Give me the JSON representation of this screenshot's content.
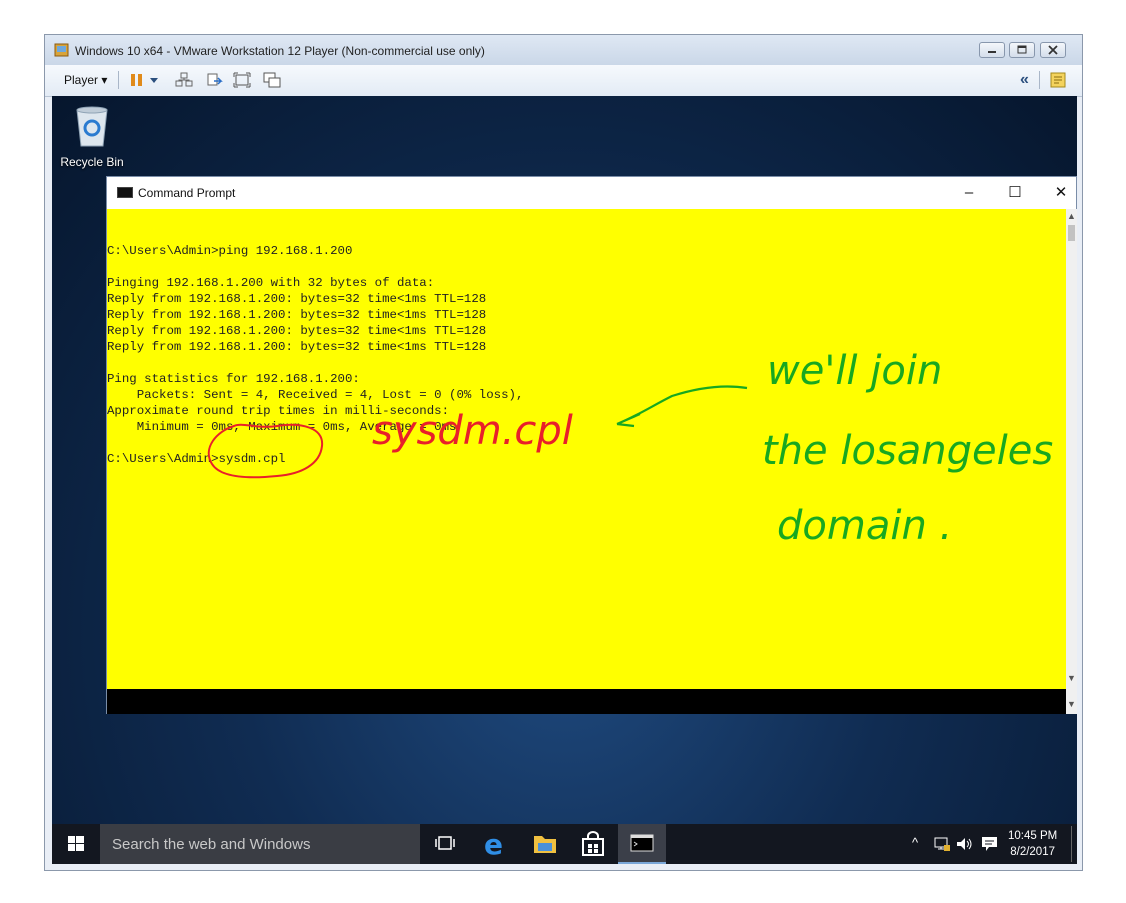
{
  "vmware": {
    "title": "Windows 10 x64 - VMware Workstation 12 Player (Non-commercial use only)",
    "player_menu": "Player ▾",
    "collapse_glyph": "«"
  },
  "desktop": {
    "recycle_bin": "Recycle Bin"
  },
  "cmd": {
    "title": "Command Prompt",
    "minimize": "–",
    "maximize": "☐",
    "close": "✕",
    "lines": [
      "",
      "C:\\Users\\Admin>ping 192.168.1.200",
      "",
      "Pinging 192.168.1.200 with 32 bytes of data:",
      "Reply from 192.168.1.200: bytes=32 time<1ms TTL=128",
      "Reply from 192.168.1.200: bytes=32 time<1ms TTL=128",
      "Reply from 192.168.1.200: bytes=32 time<1ms TTL=128",
      "Reply from 192.168.1.200: bytes=32 time<1ms TTL=128",
      "",
      "Ping statistics for 192.168.1.200:",
      "    Packets: Sent = 4, Received = 4, Lost = 0 (0% loss),",
      "Approximate round trip times in milli-seconds:",
      "    Minimum = 0ms, Maximum = 0ms, Average = 0ms",
      "",
      "C:\\Users\\Admin>sysdm.cpl"
    ]
  },
  "annotations": {
    "red_note": "sysdm.cpl",
    "green_note_line1": "we'll join",
    "green_note_line2": "the losangeles",
    "green_note_line3": "domain .",
    "red_color": "#e8202a",
    "green_color": "#18a820"
  },
  "taskbar": {
    "search_placeholder": "Search the web and Windows",
    "tray_chevron": "^",
    "time": "10:45 PM",
    "date": "8/2/2017"
  }
}
